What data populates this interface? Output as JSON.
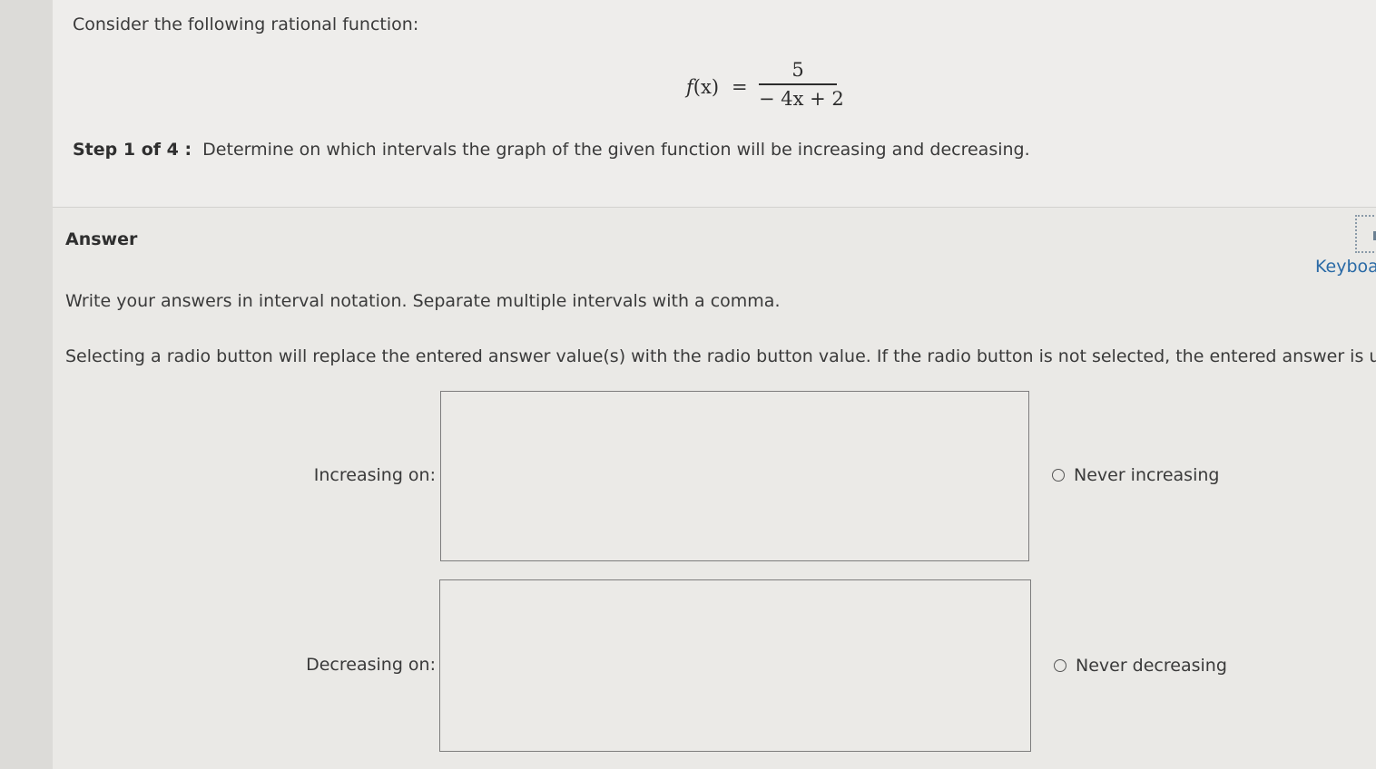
{
  "question": {
    "prompt": "Consider the following rational function:",
    "formula": {
      "lhs_func": "f",
      "lhs_arg": "(x)",
      "equals": "=",
      "numerator": "5",
      "denominator": "− 4x + 2"
    },
    "step_label": "Step 1 of 4 :",
    "step_text": "Determine on which intervals the graph of the given function will be increasing and decreasing."
  },
  "answer": {
    "heading": "Answer",
    "keyboard_label": "Keyboa",
    "instruction_1": "Write your answers in interval notation. Separate multiple intervals with a comma.",
    "instruction_2": "Selecting a radio button will replace the entered answer value(s) with the radio button value. If the radio button is not selected, the entered answer is used.",
    "rows": [
      {
        "label": "Increasing on:",
        "value": "",
        "radio_label": "Never increasing",
        "radio_selected": false
      },
      {
        "label": "Decreasing on:",
        "value": "",
        "radio_label": "Never decreasing",
        "radio_selected": false
      }
    ]
  }
}
